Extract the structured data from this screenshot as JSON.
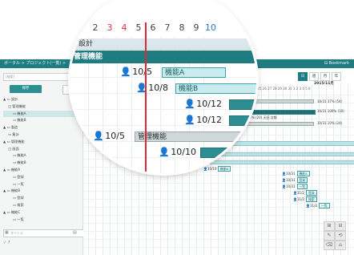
{
  "app": {
    "breadcrumb": "ポータル > プロジェクト(一覧) >",
    "bookmark": "Bookmark"
  },
  "sidebar": {
    "search_placeholder": "[検索]",
    "save_label": "保存",
    "items": [
      {
        "label": "▲ ▭ 設計",
        "level": 0
      },
      {
        "label": "◫ 管理機能",
        "level": 1
      },
      {
        "label": "▭ 機能A",
        "level": 2,
        "selected": true
      },
      {
        "label": "▭ 機能B",
        "level": 2
      },
      {
        "label": "▲ ▭ 製造",
        "level": 0
      },
      {
        "label": "▭ 集計",
        "level": 1
      },
      {
        "label": "▲ ▭ 管理機能",
        "level": 0
      },
      {
        "label": "◫ 画面",
        "level": 1
      },
      {
        "label": "▭ 機能A",
        "level": 2
      },
      {
        "label": "▭ 機能B",
        "level": 2
      },
      {
        "label": "▲ ▭ 機能A",
        "level": 0
      },
      {
        "label": "▭ 登録",
        "level": 2
      },
      {
        "label": "▭ 一覧",
        "level": 2
      },
      {
        "label": "▲ ▭ 機能B",
        "level": 0
      },
      {
        "label": "▭ 登録",
        "level": 2
      },
      {
        "label": "▭ 検索",
        "level": 2
      },
      {
        "label": "▲ ▭ 機能C",
        "level": 0
      },
      {
        "label": "▭ 一覧",
        "level": 2
      }
    ],
    "bottom_placeholder": "タイトル",
    "bottom_icons": "✓  ?"
  },
  "gantt": {
    "view_buttons": [
      "日",
      "週",
      "月",
      "年"
    ],
    "month_label": "2015/11月",
    "header_days": "21 22 23 24 25 26 27 28 29 30 31  1  2  3  4  5  6",
    "progress_rows": [
      {
        "text": "10/31  37% (54)"
      },
      {
        "text": "10/31 100% (10)"
      },
      {
        "text": "10/31  10% (24)"
      }
    ],
    "mid_note": "10/18 40% (20) 天田 次郎",
    "small_tasks": [
      {
        "date": "10/19",
        "name": "機能B"
      },
      {
        "date": "10/31",
        "name": "機能A"
      },
      {
        "date": "10/31",
        "name": "登録"
      },
      {
        "date": "10/31",
        "name": "一覧"
      },
      {
        "date": "11/2",
        "name": "登録"
      },
      {
        "date": "11/2",
        "name": "検索"
      },
      {
        "date": "11/4",
        "name": "一覧"
      }
    ],
    "tools": [
      "⊞",
      "⊟",
      "✎",
      "⟲",
      "⌫",
      "⌂"
    ]
  },
  "lens": {
    "day_numbers": [
      "2",
      "3",
      "4",
      "5",
      "6",
      "7",
      "8",
      "9",
      "10"
    ],
    "top_partial": "▸ 3",
    "section_caption": "設計",
    "band_label": "管理機能",
    "rows": [
      {
        "date": "10/5",
        "task": "機能A"
      },
      {
        "date": "10/8",
        "task": "機能B"
      },
      {
        "date": "10/12",
        "task": ""
      },
      {
        "date": "10/12",
        "task": ""
      },
      {
        "date": "10/5",
        "task": "管理機能"
      },
      {
        "date": "10/10",
        "task": ""
      }
    ],
    "colors": {
      "accent": "#1f7d82",
      "today_line": "#d92a35",
      "weekend_red": "#d9363e",
      "weekend_blue": "#2d72c9"
    }
  }
}
